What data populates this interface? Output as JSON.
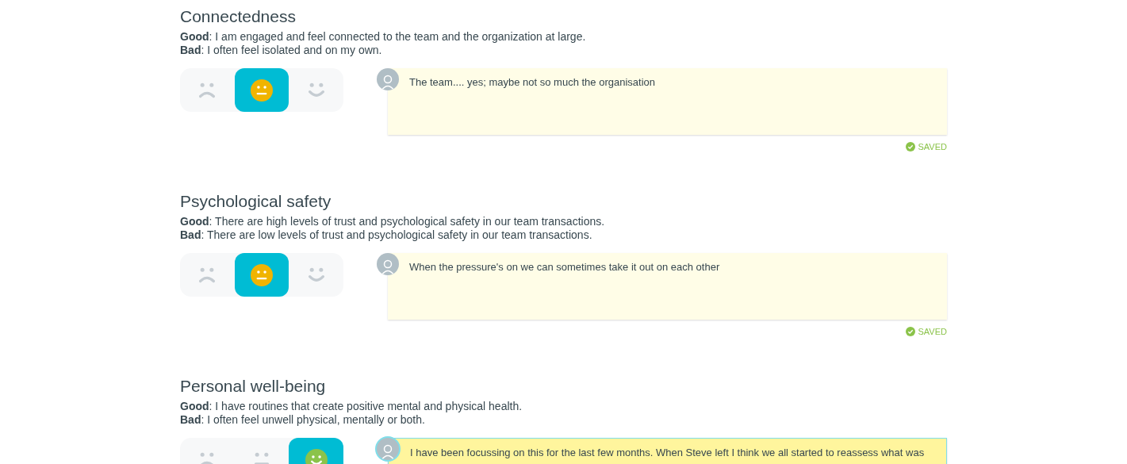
{
  "sections": [
    {
      "title": "Connectedness",
      "good": "**Good**: I am engaged and feel connected to the team and the organization at large.",
      "bad": "**Bad**: I often feel isolated and on my own.",
      "moods": [
        {
          "kind": "sad",
          "selected": false
        },
        {
          "kind": "neutral",
          "selected": true
        },
        {
          "kind": "happy",
          "selected": false
        }
      ],
      "comment": {
        "text": "The team.... yes; maybe not so much the organisation",
        "focused": false
      },
      "status": "SAVED"
    },
    {
      "title": "Psychological safety",
      "good": "**Good**: There are high levels of trust and psychological safety in our team transactions.",
      "bad": "**Bad**: There are low levels of trust and psychological safety in our team transactions.",
      "moods": [
        {
          "kind": "sad",
          "selected": false
        },
        {
          "kind": "neutral",
          "selected": true
        },
        {
          "kind": "happy",
          "selected": false
        }
      ],
      "comment": {
        "text": "When the pressure's on we can sometimes take it out on each other",
        "focused": false
      },
      "status": "SAVED"
    },
    {
      "title": "Personal well-being",
      "good": "**Good**: I have routines that create positive mental and physical health.",
      "bad": "**Bad**: I often feel unwell physical, mentally or both.",
      "moods": [
        {
          "kind": "sad",
          "selected": false
        },
        {
          "kind": "neutral",
          "selected": false
        },
        {
          "kind": "happy",
          "selected": true
        }
      ],
      "comment": {
        "text": "I have been focussing on this for the last few months. When Steve left I think we all started to reassess what was",
        "focused": true
      }
    }
  ]
}
